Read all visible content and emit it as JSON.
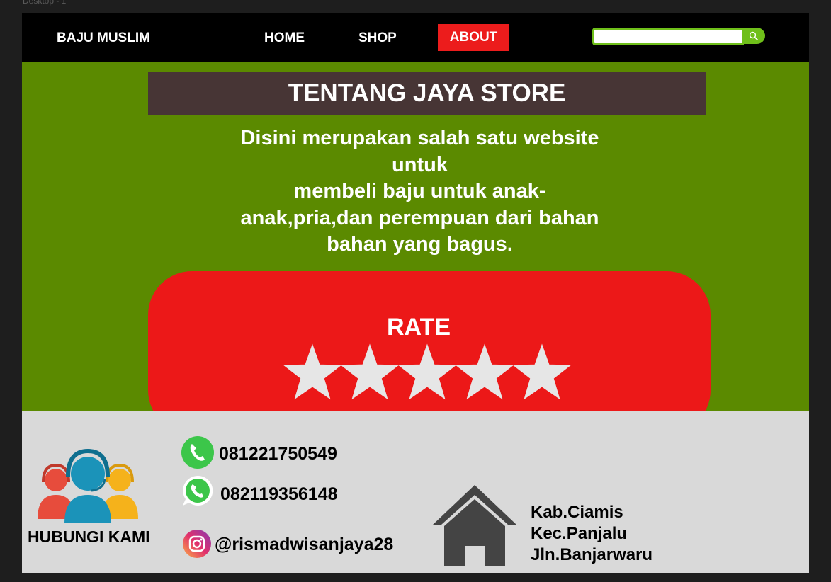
{
  "canvas": {
    "label": "Desktop - 1"
  },
  "nav": {
    "brand": "BAJU MUSLIM",
    "links": [
      {
        "label": "HOME",
        "active": false
      },
      {
        "label": "SHOP",
        "active": false
      },
      {
        "label": "ABOUT",
        "active": true
      }
    ],
    "search": {
      "value": "",
      "placeholder": "",
      "icon": "search-icon"
    }
  },
  "about": {
    "title": "TENTANG JAYA STORE",
    "description_lines": [
      "Disini merupakan salah satu website",
      "untuk",
      "membeli baju untuk anak-",
      "anak,pria,dan perempuan dari bahan",
      "bahan yang bagus."
    ]
  },
  "rating": {
    "label": "RATE",
    "stars": 5,
    "max_stars": 5
  },
  "footer": {
    "contact_title": "HUBUNGI KAMI",
    "phone": "081221750549",
    "whatsapp": "082119356148",
    "instagram": "@rismadwisanjaya28",
    "address_lines": [
      "Kab.Ciamis",
      "Kec.Panjalu",
      "Jln.Banjarwaru"
    ]
  },
  "colors": {
    "nav_bg": "#000000",
    "page_bg": "#5b8a00",
    "active_tab": "#ec1c1c",
    "title_bar": "#473535",
    "rate_box": "#ec1818",
    "footer_bg": "#d9d9d9",
    "search_accent": "#6fbf1a"
  }
}
